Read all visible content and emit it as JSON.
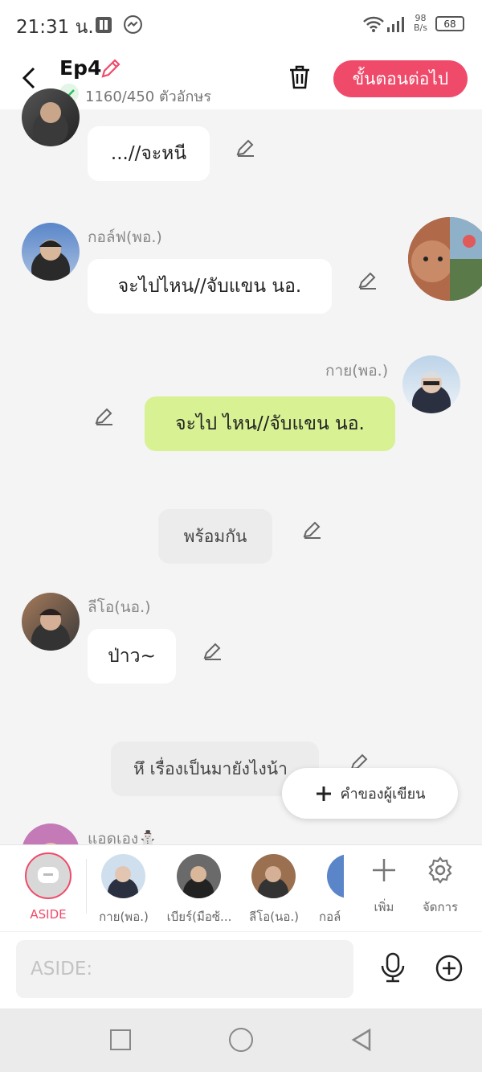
{
  "status_bar": {
    "time": "21:31 น.",
    "net_speed_top": "98",
    "net_speed_unit": "B/s",
    "battery": "68"
  },
  "header": {
    "title": "Ep4",
    "char_count": "1160/450 ตัวอักษร",
    "next_button": "ขั้นตอนต่อไป"
  },
  "messages": [
    {
      "text": "...//จะหนี"
    },
    {
      "speaker": "กอล์ฟ(พอ.)",
      "text": "จะไปไหน//จับแขน นอ."
    },
    {
      "speaker": "กาย(พอ.)",
      "text": "จะไป ไหน//จับแขน นอ."
    },
    {
      "text": "พร้อมกัน"
    },
    {
      "speaker": "ลีโอ(นอ.)",
      "text": "ป่าว~"
    },
    {
      "text": "หึ เรื่องเป็นมายังไงน้า"
    },
    {
      "speaker": "แอดเอง⛄"
    }
  ],
  "fab_label": "คำของผู้เขียน",
  "characters": [
    {
      "label": "ASIDE"
    },
    {
      "label": "กาย(พอ.)"
    },
    {
      "label": "เบียร์(มือซ้..."
    },
    {
      "label": "ลีโอ(นอ.)"
    },
    {
      "label": "กอล์"
    }
  ],
  "char_actions": {
    "add": "เพิ่ม",
    "manage": "จัดการ"
  },
  "input": {
    "placeholder": "ASIDE:"
  },
  "colors": {
    "accent": "#f04a6a",
    "green_bubble": "#d7f193"
  }
}
